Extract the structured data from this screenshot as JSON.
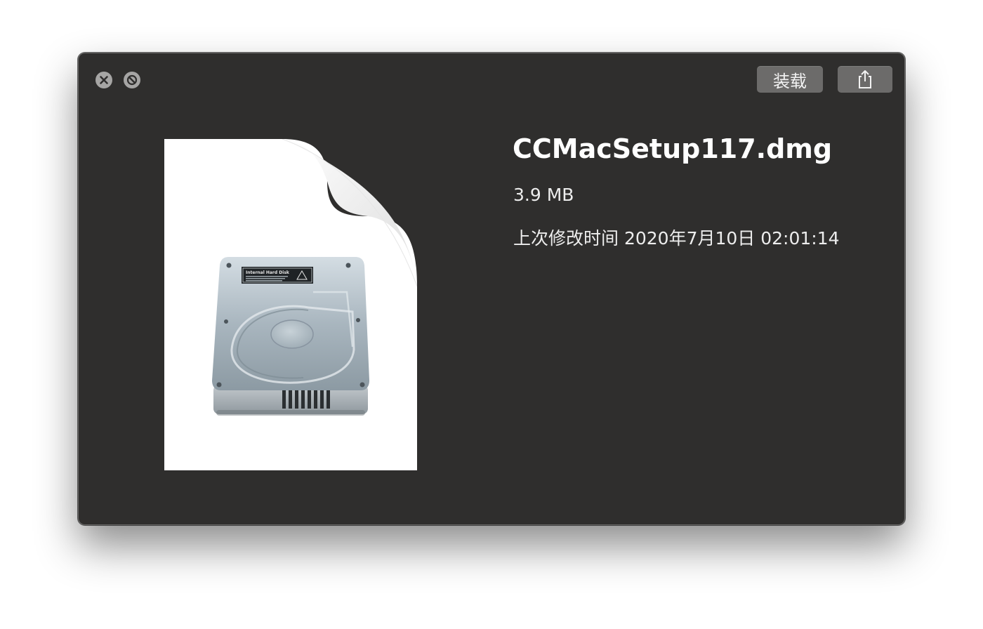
{
  "toolbar": {
    "mount_label": "装载",
    "share_icon": "share-icon"
  },
  "controls": {
    "close_icon": "close-icon",
    "fullscreen_icon": "exit-fullscreen-icon"
  },
  "file": {
    "name": "CCMacSetup117.dmg",
    "size": "3.9 MB",
    "modified": "上次修改时间 2020年7月10日 02:01:14",
    "icon": "disk-image-icon",
    "label_title": "Internal Hard Disk"
  },
  "colors": {
    "window_bg": "#2f2e2d",
    "button_bg": "#6c6b6a",
    "text": "#ffffff"
  }
}
